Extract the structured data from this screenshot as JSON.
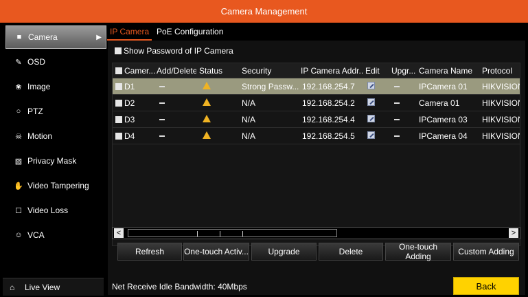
{
  "window": {
    "title": "Camera Management"
  },
  "sidebar": {
    "items": [
      {
        "label": "Camera",
        "icon": "camera-icon",
        "glyph": "■",
        "active": true
      },
      {
        "label": "OSD",
        "icon": "osd-icon",
        "glyph": "✎"
      },
      {
        "label": "Image",
        "icon": "image-icon",
        "glyph": "❀"
      },
      {
        "label": "PTZ",
        "icon": "ptz-icon",
        "glyph": "○"
      },
      {
        "label": "Motion",
        "icon": "motion-icon",
        "glyph": "☠"
      },
      {
        "label": "Privacy Mask",
        "icon": "privacy-mask-icon",
        "glyph": "▧"
      },
      {
        "label": "Video Tampering",
        "icon": "video-tampering-icon",
        "glyph": "✋"
      },
      {
        "label": "Video Loss",
        "icon": "video-loss-icon",
        "glyph": "☐"
      },
      {
        "label": "VCA",
        "icon": "vca-icon",
        "glyph": "☺"
      }
    ],
    "live_view": {
      "label": "Live View",
      "icon": "home-icon",
      "glyph": "⌂"
    }
  },
  "tabs": [
    {
      "label": "IP Camera",
      "active": true
    },
    {
      "label": "PoE Configuration",
      "active": false
    }
  ],
  "show_password": {
    "label": "Show Password of IP Camera",
    "checked": false
  },
  "table": {
    "columns": [
      "Camer...",
      "Add/Delete",
      "Status",
      "Security",
      "IP Camera Addr...",
      "Edit",
      "Upgr...",
      "Camera Name",
      "Protocol"
    ],
    "rows": [
      {
        "id": "D1",
        "add_delete": "dash",
        "status": "warning",
        "security": "Strong Passw...",
        "ip": "192.168.254.7",
        "edit": "edit",
        "upgrade": "dash",
        "name": "IPCamera 01",
        "protocol": "HIKVISION",
        "selected": true
      },
      {
        "id": "D2",
        "add_delete": "dash",
        "status": "warning",
        "security": "N/A",
        "ip": "192.168.254.2",
        "edit": "edit",
        "upgrade": "dash",
        "name": "Camera 01",
        "protocol": "HIKVISION",
        "selected": false
      },
      {
        "id": "D3",
        "add_delete": "dash",
        "status": "warning",
        "security": "N/A",
        "ip": "192.168.254.4",
        "edit": "edit",
        "upgrade": "dash",
        "name": "IPCamera 03",
        "protocol": "HIKVISION",
        "selected": false
      },
      {
        "id": "D4",
        "add_delete": "dash",
        "status": "warning",
        "security": "N/A",
        "ip": "192.168.254.5",
        "edit": "edit",
        "upgrade": "dash",
        "name": "IPCamera 04",
        "protocol": "HIKVISION",
        "selected": false
      }
    ]
  },
  "scrollbar": {
    "left_glyph": "<",
    "right_glyph": ">"
  },
  "buttons": {
    "refresh": "Refresh",
    "one_touch_activate": "One-touch Activ...",
    "upgrade": "Upgrade",
    "delete": "Delete",
    "one_touch_adding": "One-touch Adding",
    "custom_adding": "Custom Adding"
  },
  "footer": {
    "bandwidth": "Net Receive Idle Bandwidth: 40Mbps",
    "back": "Back"
  },
  "colors": {
    "accent": "#e8581f",
    "back_button": "#ffd200",
    "warning": "#f0b323",
    "selected_row": "#9a9a7f"
  }
}
